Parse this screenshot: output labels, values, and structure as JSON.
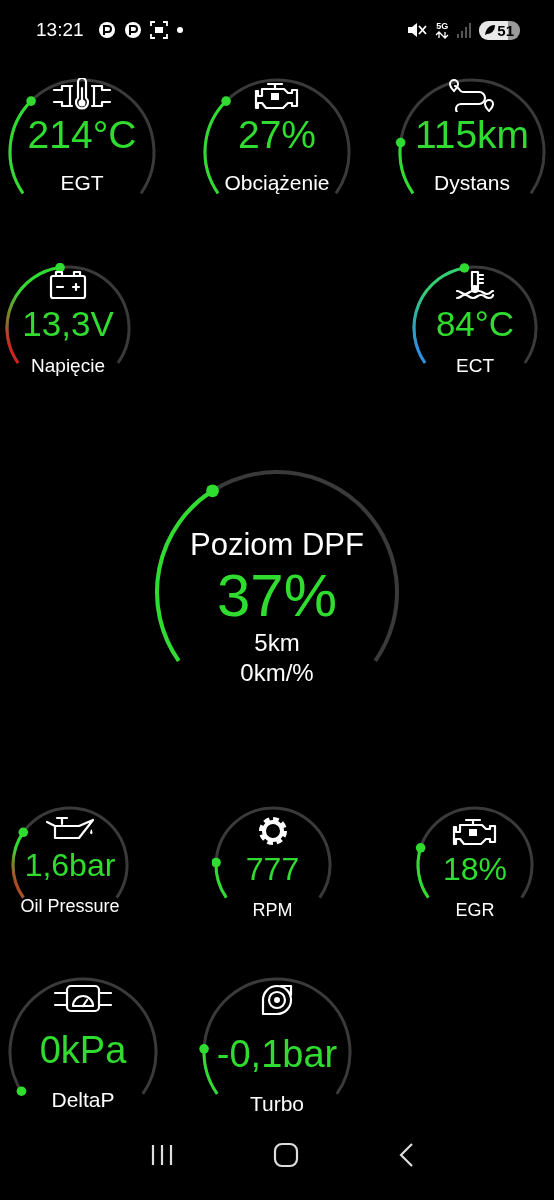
{
  "status_bar": {
    "time": "13:21",
    "network": "5G",
    "battery": "51"
  },
  "top_rows": [
    {
      "gauges": [
        {
          "value": "214°C",
          "label": "EGT"
        },
        {
          "value": "27%",
          "label": "Obciążenie"
        },
        {
          "value": "115km",
          "label": "Dystans"
        }
      ]
    },
    {
      "gauges": [
        {
          "value": "13,3V",
          "label": "Napięcie"
        },
        {
          "value": "84°C",
          "label": "ECT"
        }
      ]
    }
  ],
  "dpf": {
    "title": "Poziom DPF",
    "value": "37%",
    "lines": [
      "5km",
      "0km/%"
    ]
  },
  "bottom_rows": [
    {
      "gauges": [
        {
          "value": "1,6bar",
          "label": "Oil Pressure"
        },
        {
          "value": "777",
          "label": "RPM"
        },
        {
          "value": "18%",
          "label": "EGR"
        }
      ]
    },
    {
      "gauges": [
        {
          "value": "0kPa",
          "label": "DeltaP"
        },
        {
          "value": "-0,1bar",
          "label": "Turbo"
        }
      ]
    }
  ]
}
